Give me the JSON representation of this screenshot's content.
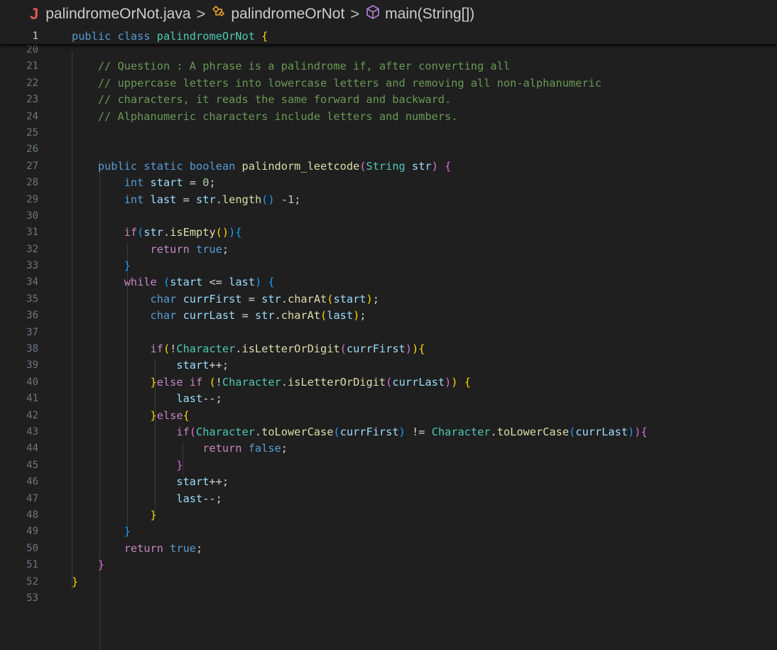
{
  "breadcrumb": {
    "file_icon_letter": "J",
    "file": "palindromeOrNot.java",
    "class_name": "palindromeOrNot",
    "method": "main(String[])",
    "separator": ">",
    "icons": [
      "java-file-icon",
      "class-icon",
      "method-cube-icon"
    ]
  },
  "sticky": {
    "line_number": "1",
    "text": "public class palindromeOrNot {"
  },
  "editor": {
    "lines": [
      {
        "n": "20",
        "text": ""
      },
      {
        "n": "21",
        "text": "    // Question : A phrase is a palindrome if, after converting all"
      },
      {
        "n": "22",
        "text": "    // uppercase letters into lowercase letters and removing all non-alphanumeric"
      },
      {
        "n": "23",
        "text": "    // characters, it reads the same forward and backward."
      },
      {
        "n": "24",
        "text": "    // Alphanumeric characters include letters and numbers."
      },
      {
        "n": "25",
        "text": ""
      },
      {
        "n": "26",
        "text": ""
      },
      {
        "n": "27",
        "text": "    public static boolean palindorm_leetcode(String str) {"
      },
      {
        "n": "28",
        "text": "        int start = 0;"
      },
      {
        "n": "29",
        "text": "        int last = str.length() -1;"
      },
      {
        "n": "30",
        "text": ""
      },
      {
        "n": "31",
        "text": "        if(str.isEmpty()){"
      },
      {
        "n": "32",
        "text": "            return true;"
      },
      {
        "n": "33",
        "text": "        }"
      },
      {
        "n": "34",
        "text": "        while (start <= last) {"
      },
      {
        "n": "35",
        "text": "            char currFirst = str.charAt(start);"
      },
      {
        "n": "36",
        "text": "            char currLast = str.charAt(last);"
      },
      {
        "n": "37",
        "text": ""
      },
      {
        "n": "38",
        "text": "            if(!Character.isLetterOrDigit(currFirst)){"
      },
      {
        "n": "39",
        "text": "                start++;"
      },
      {
        "n": "40",
        "text": "            }else if (!Character.isLetterOrDigit(currLast)) {"
      },
      {
        "n": "41",
        "text": "                last--;"
      },
      {
        "n": "42",
        "text": "            }else{"
      },
      {
        "n": "43",
        "text": "                if(Character.toLowerCase(currFirst) != Character.toLowerCase(currLast)){"
      },
      {
        "n": "44",
        "text": "                    return false;"
      },
      {
        "n": "45",
        "text": "                }"
      },
      {
        "n": "46",
        "text": "                start++;"
      },
      {
        "n": "47",
        "text": "                last--;"
      },
      {
        "n": "48",
        "text": "            }"
      },
      {
        "n": "49",
        "text": "        }"
      },
      {
        "n": "50",
        "text": "        return true;"
      },
      {
        "n": "51",
        "text": "    }"
      },
      {
        "n": "52",
        "text": "}"
      },
      {
        "n": "53",
        "text": ""
      }
    ]
  },
  "colors": {
    "background": "#1f1f1f",
    "keyword": "#569cd6",
    "control": "#c586c0",
    "type": "#4ec9b0",
    "function": "#dcdcaa",
    "variable": "#9cdcfe",
    "number": "#b5cea8",
    "comment": "#6a9955",
    "bracket_gold": "#ffd700",
    "bracket_orchid": "#da70d6",
    "bracket_blue": "#179fff",
    "java_icon": "#e05a4f",
    "class_icon": "#ee9d28",
    "method_icon": "#b180d7"
  }
}
